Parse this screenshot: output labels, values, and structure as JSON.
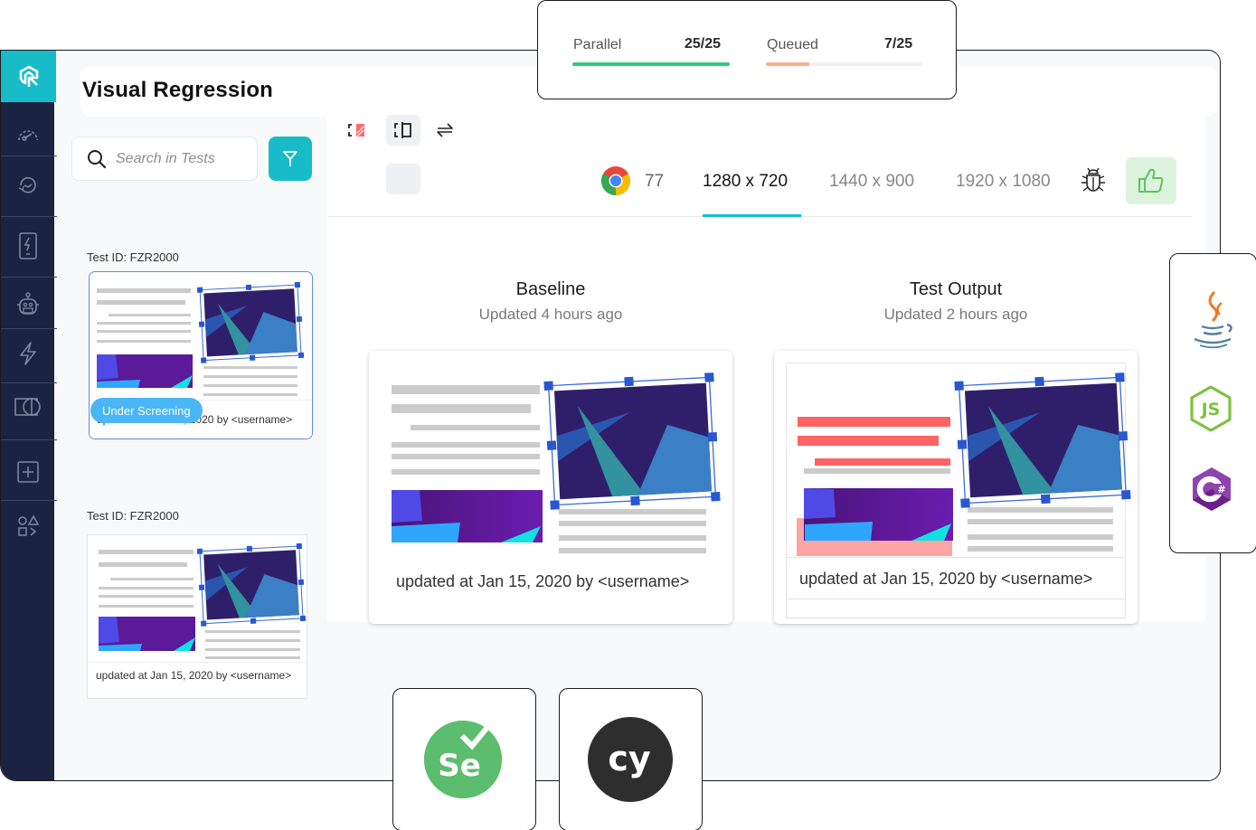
{
  "concurrency": {
    "parallel": {
      "label": "Parallel",
      "value": "25/25",
      "fraction": 1.0,
      "color": "#2ecc7a"
    },
    "queued": {
      "label": "Queued",
      "value": "7/25",
      "fraction": 0.28,
      "color": "#ffae8a"
    }
  },
  "sidebar": {
    "items": [
      {
        "icon": "logo-icon",
        "active": true
      },
      {
        "icon": "speedometer-icon"
      },
      {
        "icon": "clock-refresh-icon"
      },
      {
        "icon": "mobile-lightning-icon"
      },
      {
        "icon": "robot-icon"
      },
      {
        "icon": "lightning-icon"
      },
      {
        "icon": "visual-compare-icon"
      },
      {
        "icon": "plus-square-icon"
      },
      {
        "icon": "integrations-icon"
      }
    ]
  },
  "page": {
    "title": "Visual Regression"
  },
  "search": {
    "placeholder": "Search in Tests"
  },
  "tests": [
    {
      "id_label": "Test ID: FZR2000",
      "footer": "updated at Jan 15, 2020 by <username>",
      "status": "Under Screening",
      "selected": true
    },
    {
      "id_label": "Test ID: FZR2000",
      "footer": "updated at Jan 15, 2020 by <username>",
      "selected": false
    }
  ],
  "toolbar": {
    "browser": {
      "name": "chrome",
      "version": "77"
    },
    "resolutions": [
      "1280 x 720",
      "1440 x 900",
      "1920 x 1080"
    ],
    "active_resolution": "1280 x 720",
    "accent": "#17bcc8"
  },
  "comparison": {
    "baseline": {
      "title": "Baseline",
      "subtitle": "Updated 4 hours ago",
      "footer": "updated at Jan 15, 2020 by <username>"
    },
    "output": {
      "title": "Test Output",
      "subtitle": "Updated 2 hours ago",
      "footer": "updated at Jan 15, 2020 by <username>"
    }
  },
  "languages": [
    "Java",
    "Node.js",
    "C#"
  ],
  "frameworks": [
    "Selenium",
    "Cypress"
  ]
}
